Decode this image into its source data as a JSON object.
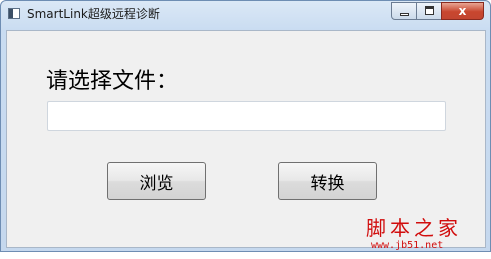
{
  "window": {
    "title": "SmartLink超级远程诊断"
  },
  "controls": {
    "minimize": "",
    "maximize": "",
    "close": "x"
  },
  "form": {
    "prompt": "请选择文件：",
    "file_path_value": "",
    "browse_label": "浏览",
    "convert_label": "转换"
  },
  "watermark": {
    "text": "脚本之家",
    "url": "www.jb51.net"
  },
  "icons": [
    "app-icon",
    "minimize-icon",
    "maximize-icon",
    "close-icon"
  ]
}
